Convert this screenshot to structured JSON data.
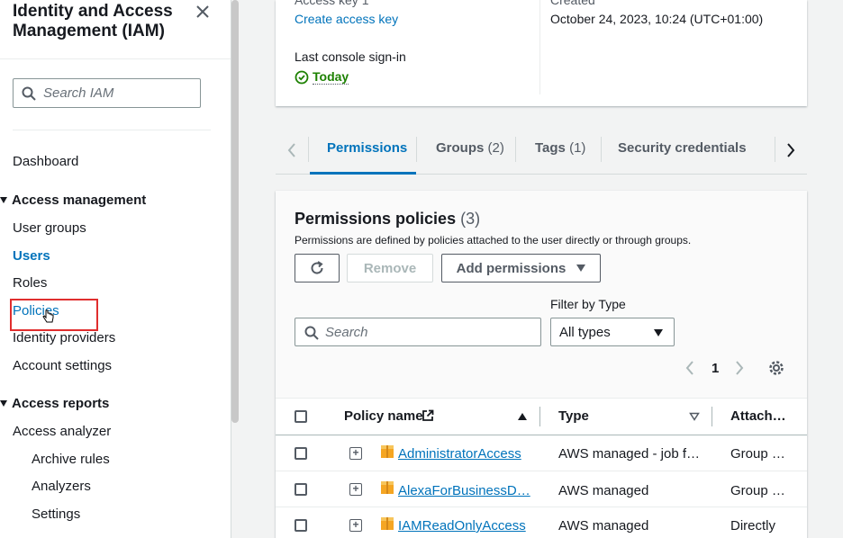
{
  "sidebar": {
    "title": "Identity and Access Management (IAM)",
    "search_placeholder": "Search IAM",
    "items": {
      "dashboard": "Dashboard",
      "access_management": "Access management",
      "user_groups": "User groups",
      "users": "Users",
      "roles": "Roles",
      "policies": "Policies",
      "identity_providers": "Identity providers",
      "account_settings": "Account settings",
      "access_reports": "Access reports",
      "access_analyzer": "Access analyzer",
      "archive_rules": "Archive rules",
      "analyzers": "Analyzers",
      "settings": "Settings"
    }
  },
  "summary": {
    "access_key_label": "Access key 1",
    "create_access_key": "Create access key",
    "last_signin_label": "Last console sign-in",
    "last_signin_value": "Today",
    "created_label": "Created",
    "created_value": "October 24, 2023, 10:24 (UTC+01:00)"
  },
  "tabs": [
    {
      "label": "Permissions",
      "count": ""
    },
    {
      "label": "Groups",
      "count": "(2)"
    },
    {
      "label": "Tags",
      "count": "(1)"
    },
    {
      "label": "Security credentials",
      "count": ""
    }
  ],
  "permissions": {
    "title": "Permissions policies",
    "count": "(3)",
    "description": "Permissions are defined by policies attached to the user directly or through groups.",
    "remove_label": "Remove",
    "add_label": "Add permissions",
    "filter_label": "Filter by Type",
    "search_placeholder": "Search",
    "type_value": "All types",
    "page": "1",
    "columns": {
      "name": "Policy name",
      "type": "Type",
      "attached": "Attach…"
    },
    "rows": [
      {
        "name": "AdministratorAccess",
        "type": "AWS managed - job f…",
        "attached": "Group …"
      },
      {
        "name": "AlexaForBusinessD…",
        "type": "AWS managed",
        "attached": "Group …"
      },
      {
        "name": "IAMReadOnlyAccess",
        "type": "AWS managed",
        "attached": "Directly"
      }
    ]
  }
}
